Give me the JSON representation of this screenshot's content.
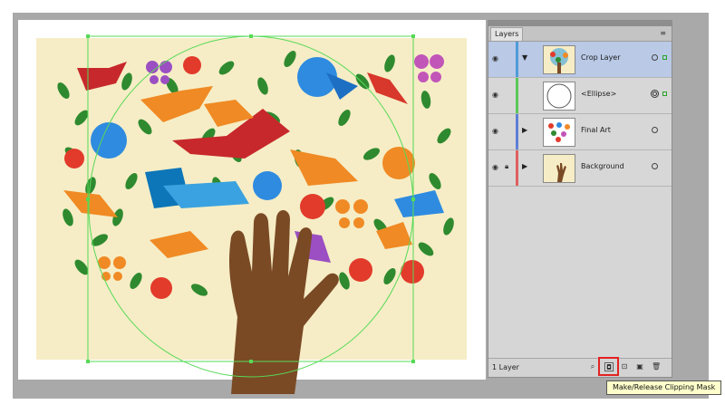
{
  "panel": {
    "tab_label": "Layers",
    "menu_icon": "panel-menu-icon",
    "layers": [
      {
        "name": "Crop Layer",
        "selected": true,
        "color": "#4f9bd8",
        "expandable": true,
        "thumbnail": "tree-thumbnail"
      },
      {
        "name": "<Ellipse>",
        "selected": false,
        "color": "#59c759",
        "expandable": false,
        "thumbnail": "ellipse-thumbnail"
      },
      {
        "name": "Final Art",
        "selected": false,
        "color": "#5f7fd6",
        "expandable": true,
        "thumbnail": "art-thumbnail"
      },
      {
        "name": "Background",
        "selected": false,
        "color": "#e06060",
        "expandable": true,
        "thumbnail": "hand-thumbnail",
        "locked": true
      }
    ],
    "footer": {
      "count_label": "1 Layer"
    }
  },
  "tooltip": {
    "text": "Make/Release Clipping Mask"
  },
  "colors": {
    "selection_green": "#57d957",
    "highlight_red": "#e32222",
    "hand_brown": "#7a4a25",
    "leaf_green": "#2f8a2f",
    "bg_cream": "#f6edc6"
  }
}
